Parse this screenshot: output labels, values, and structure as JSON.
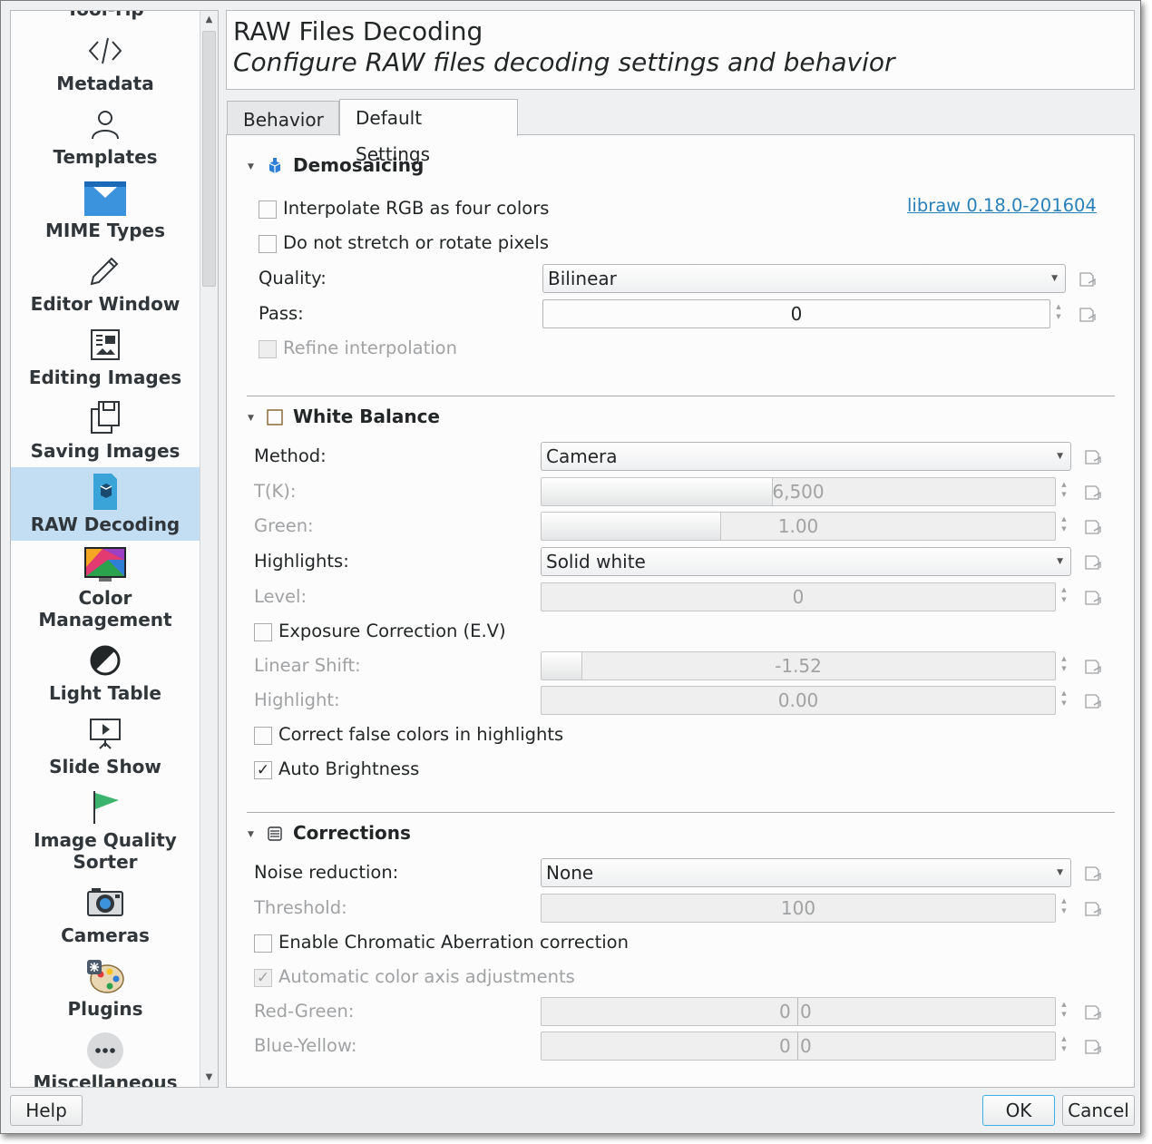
{
  "sidebar": {
    "items": [
      {
        "label": "Tool-Tip",
        "icon": "tooltip-icon"
      },
      {
        "label": "Metadata",
        "icon": "code-icon"
      },
      {
        "label": "Templates",
        "icon": "user-icon"
      },
      {
        "label": "MIME Types",
        "icon": "folder-mail-icon"
      },
      {
        "label": "Editor Window",
        "icon": "pencil-icon"
      },
      {
        "label": "Editing Images",
        "icon": "image-document-icon"
      },
      {
        "label": "Saving Images",
        "icon": "save-icon"
      },
      {
        "label": "RAW Decoding",
        "icon": "raw-file-icon"
      },
      {
        "label": "Color",
        "label2": "Management",
        "icon": "monitor-color-icon"
      },
      {
        "label": "Light Table",
        "icon": "contrast-icon"
      },
      {
        "label": "Slide Show",
        "icon": "presentation-icon"
      },
      {
        "label": "Image Quality",
        "label2": "Sorter",
        "icon": "flag-icon"
      },
      {
        "label": "Cameras",
        "icon": "camera-icon"
      },
      {
        "label": "Plugins",
        "icon": "palette-icon"
      },
      {
        "label": "Miscellaneous",
        "icon": "more-icon"
      }
    ]
  },
  "header": {
    "title": "RAW Files Decoding",
    "subtitle": "Configure RAW files decoding settings and behavior"
  },
  "tabs": [
    {
      "label": "Behavior",
      "active": false
    },
    {
      "label": "Default Settings",
      "active": true
    }
  ],
  "demosaicing": {
    "title": "Demosaicing",
    "interpolate_label": "Interpolate RGB as four colors",
    "interpolate_checked": false,
    "libraw_link": "libraw 0.18.0-201604",
    "no_stretch_label": "Do not stretch or rotate pixels",
    "no_stretch_checked": false,
    "quality_label": "Quality:",
    "quality_value": "Bilinear",
    "pass_label": "Pass:",
    "pass_value": "0",
    "refine_label": "Refine interpolation",
    "refine_checked": false
  },
  "white_balance": {
    "title": "White Balance",
    "method_label": "Method:",
    "method_value": "Camera",
    "tk_label": "T(K):",
    "tk_value": "6,500",
    "tk_fraction": 0.45,
    "green_label": "Green:",
    "green_value": "1.00",
    "green_fraction": 0.35,
    "highlights_label": "Highlights:",
    "highlights_value": "Solid white",
    "level_label": "Level:",
    "level_value": "0",
    "exposure_label": "Exposure Correction (E.V)",
    "exposure_checked": false,
    "linear_shift_label": "Linear Shift:",
    "linear_shift_value": "-1.52",
    "linear_shift_fraction": 0.08,
    "highlight_label": "Highlight:",
    "highlight_value": "0.00",
    "false_colors_label": "Correct false colors in highlights",
    "false_colors_checked": false,
    "auto_brightness_label": "Auto Brightness",
    "auto_brightness_checked": true
  },
  "corrections": {
    "title": "Corrections",
    "noise_label": "Noise reduction:",
    "noise_value": "None",
    "threshold_label": "Threshold:",
    "threshold_value": "100",
    "chromatic_label": "Enable Chromatic Aberration correction",
    "chromatic_checked": false,
    "auto_color_label": "Automatic color axis adjustments",
    "auto_color_checked": true,
    "red_green_label": "Red-Green:",
    "red_green_value": "0",
    "red_green_value2": "0",
    "blue_yellow_label": "Blue-Yellow:",
    "blue_yellow_value": "0",
    "blue_yellow_value2": "0"
  },
  "buttons": {
    "help": "Help",
    "ok": "OK",
    "cancel": "Cancel"
  },
  "check_glyph": "✓",
  "colors": {
    "selection": "#c3def2",
    "link": "#2980b9",
    "focus": "#3daee9"
  }
}
